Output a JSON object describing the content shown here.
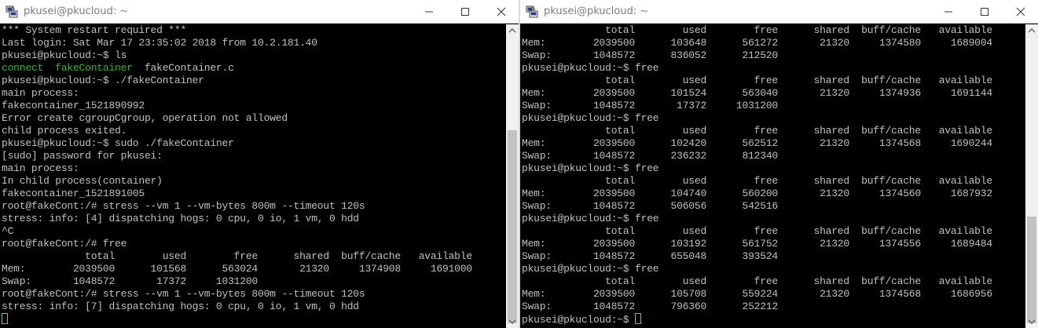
{
  "left_window": {
    "title": "pkusei@pkucloud: ~",
    "icon": "putty-icon",
    "lines": [
      [
        {
          "t": "*** System restart required ***"
        }
      ],
      [
        {
          "t": "Last login: Sat Mar 17 23:35:02 2018 from 10.2.181.40"
        }
      ],
      [
        {
          "t": "pkusei@pkucloud:~$ ls"
        }
      ],
      [
        {
          "t": "connect  fakeContainer",
          "c": "hl"
        },
        {
          "t": "  fakeContainer.c"
        }
      ],
      [
        {
          "t": "pkusei@pkucloud:~$ ./fakeContainer"
        }
      ],
      [
        {
          "t": "main process:"
        }
      ],
      [
        {
          "t": "fakecontainer_1521890992"
        }
      ],
      [
        {
          "t": "Error create cgroupCgroup, operation not allowed"
        }
      ],
      [
        {
          "t": "child process exited."
        }
      ],
      [
        {
          "t": "pkusei@pkucloud:~$ sudo ./fakeContainer"
        }
      ],
      [
        {
          "t": "[sudo] password for pkusei:"
        }
      ],
      [
        {
          "t": "main process:"
        }
      ],
      [
        {
          "t": "In child process(container)"
        }
      ],
      [
        {
          "t": "fakecontainer_1521891005"
        }
      ],
      [
        {
          "t": "root@fakeCont:/# stress --vm 1 --vm-bytes 800m --timeout 120s"
        }
      ],
      [
        {
          "t": "stress: info: [4] dispatching hogs: 0 cpu, 0 io, 1 vm, 0 hdd"
        }
      ],
      [
        {
          "t": "^C"
        }
      ],
      [
        {
          "t": "root@fakeCont:/# free"
        }
      ],
      [
        {
          "t": "              total        used        free      shared  buff/cache   available"
        }
      ],
      [
        {
          "t": "Mem:        2039500      101568      563024       21320     1374908     1691000"
        }
      ],
      [
        {
          "t": "Swap:       1048572       17372     1031200"
        }
      ],
      [
        {
          "t": "root@fakeCont:/# stress --vm 1 --vm-bytes 800m --timeout 120s"
        }
      ],
      [
        {
          "t": "stress: info: [7] dispatching hogs: 0 cpu, 0 io, 1 vm, 0 hdd"
        }
      ],
      [
        {
          "t": ""
        },
        {
          "cursor": true
        }
      ]
    ]
  },
  "right_window": {
    "title": "pkusei@pkucloud: ~",
    "icon": "putty-icon",
    "lines": [
      [
        {
          "t": "              total        used        free      shared  buff/cache   available"
        }
      ],
      [
        {
          "t": "Mem:        2039500      103648      561272       21320     1374580     1689004"
        }
      ],
      [
        {
          "t": "Swap:       1048572      836052      212520"
        }
      ],
      [
        {
          "t": "pkusei@pkucloud:~$ free"
        }
      ],
      [
        {
          "t": "              total        used        free      shared  buff/cache   available"
        }
      ],
      [
        {
          "t": "Mem:        2039500      101524      563040       21320     1374936     1691144"
        }
      ],
      [
        {
          "t": "Swap:       1048572       17372     1031200"
        }
      ],
      [
        {
          "t": "pkusei@pkucloud:~$ free"
        }
      ],
      [
        {
          "t": "              total        used        free      shared  buff/cache   available"
        }
      ],
      [
        {
          "t": "Mem:        2039500      102420      562512       21320     1374568     1690244"
        }
      ],
      [
        {
          "t": "Swap:       1048572      236232      812340"
        }
      ],
      [
        {
          "t": "pkusei@pkucloud:~$ free"
        }
      ],
      [
        {
          "t": "              total        used        free      shared  buff/cache   available"
        }
      ],
      [
        {
          "t": "Mem:        2039500      104740      560200       21320     1374560     1687932"
        }
      ],
      [
        {
          "t": "Swap:       1048572      506056      542516"
        }
      ],
      [
        {
          "t": "pkusei@pkucloud:~$ free"
        }
      ],
      [
        {
          "t": "              total        used        free      shared  buff/cache   available"
        }
      ],
      [
        {
          "t": "Mem:        2039500      103192      561752       21320     1374556     1689484"
        }
      ],
      [
        {
          "t": "Swap:       1048572      655048      393524"
        }
      ],
      [
        {
          "t": "pkusei@pkucloud:~$ free"
        }
      ],
      [
        {
          "t": "              total        used        free      shared  buff/cache   available"
        }
      ],
      [
        {
          "t": "Mem:        2039500      105708      559224       21320     1374568     1686956"
        }
      ],
      [
        {
          "t": "Swap:       1048572      796360      252212"
        }
      ],
      [
        {
          "t": "pkusei@pkucloud:~$ "
        },
        {
          "cursor": true
        }
      ]
    ]
  },
  "colors": {
    "terminal_bg": "#000000",
    "terminal_fg": "#c0c0c0",
    "highlight_green": "#20c020",
    "cursor": "#3fe03f",
    "titlebar_bg": "#ffffff",
    "title_text": "#7b7b7b"
  },
  "controls": [
    "minimize-icon",
    "maximize-icon",
    "close-icon"
  ]
}
